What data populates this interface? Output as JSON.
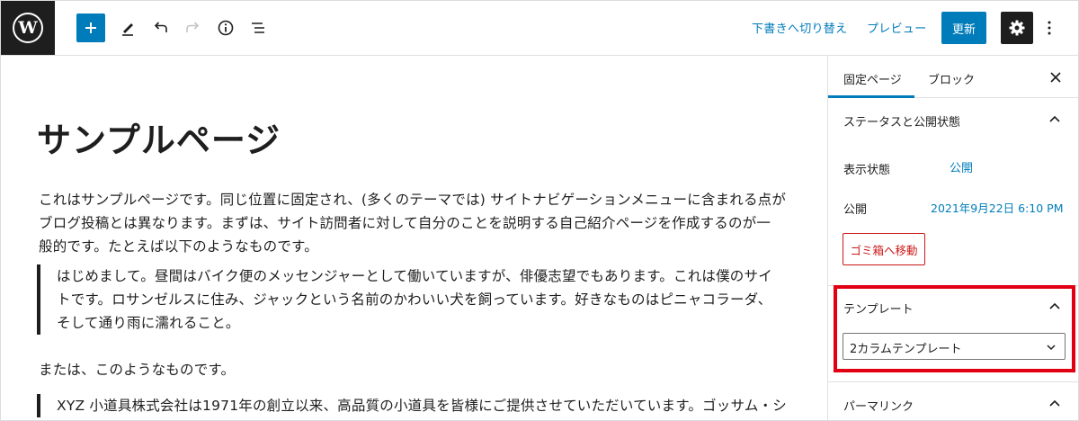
{
  "toolbar": {
    "logo_icon": "wordpress-logo-icon",
    "logo_text": "W",
    "buttons": [
      "add-block-icon",
      "edit-tools-icon",
      "undo-icon",
      "redo-icon",
      "info-icon",
      "list-view-icon"
    ],
    "switch_to_draft": "下書きへ切り替え",
    "preview": "プレビュー",
    "update": "更新",
    "settings_icon": "gear-icon",
    "options_icon": "kebab-menu-icon",
    "accent_color": "#007cba"
  },
  "editor": {
    "title": "サンプルページ",
    "paragraph1_lines": [
      "これはサンプルページです。同じ位置に固定され、(多くのテーマでは) サイトナビゲーションメニューに含まれる点が",
      "ブログ投稿とは異なります。まずは、サイト訪問者に対して自分のことを説明する自己紹介ページを作成するのが一",
      "般的です。たとえば以下のようなものです。"
    ],
    "quote1_lines": [
      "はじめまして。昼間はバイク便のメッセンジャーとして働いていますが、俳優志望でもあります。これは僕のサイ",
      "トです。ロサンゼルスに住み、ジャックという名前のかわいい犬を飼っています。好きなものはピニャコラーダ、",
      "そして通り雨に濡れること。"
    ],
    "paragraph2": "または、このようなものです。",
    "quote2_line": "XYZ 小道具株式会社は1971年の創立以来、高品質の小道具を皆様にご提供させていただいています。ゴッサム・シ"
  },
  "sidebar": {
    "tab_page": "固定ページ",
    "tab_block": "ブロック",
    "close_icon": "close-icon",
    "status_panel": {
      "title": "ステータスと公開状態",
      "visibility_label": "表示状態",
      "visibility_value": "公開",
      "publish_label": "公開",
      "publish_value": "2021年9月22日 6:10 PM",
      "trash_label": "ゴミ箱へ移動"
    },
    "template_panel": {
      "title": "テンプレート",
      "selected": "2カラムテンプレート"
    },
    "permalink_panel": {
      "title": "パーマリンク"
    },
    "highlight_color": "#e00012"
  }
}
